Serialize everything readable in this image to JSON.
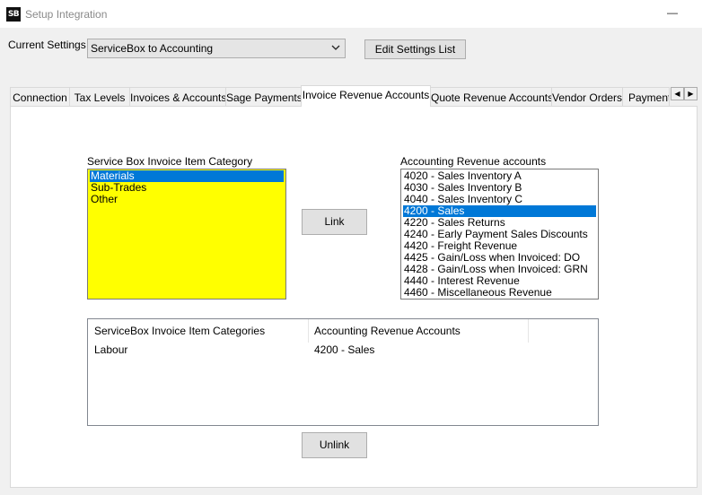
{
  "window": {
    "app_icon_text": "SB",
    "title": "Setup Integration",
    "minimize_glyph": "—"
  },
  "settings": {
    "label": "Current Settings",
    "selected": "ServiceBox to Accounting",
    "edit_button": "Edit Settings List"
  },
  "tabs": [
    {
      "label": "Connection",
      "active": false
    },
    {
      "label": "Tax Levels",
      "active": false
    },
    {
      "label": "Invoices & Accounts",
      "active": false
    },
    {
      "label": "Sage Payments",
      "active": false
    },
    {
      "label": "Invoice Revenue Accounts",
      "active": true
    },
    {
      "label": "Quote Revenue Accounts",
      "active": false
    },
    {
      "label": "Vendor Orders",
      "active": false
    },
    {
      "label": "Payment",
      "active": false
    }
  ],
  "tab_scroll": {
    "left": "◀",
    "right": "▶"
  },
  "category_list": {
    "label": "Service Box Invoice Item Category",
    "items": [
      "Materials",
      "Sub-Trades",
      "Other"
    ],
    "selected_index": 0
  },
  "revenue_list": {
    "label": "Accounting Revenue accounts",
    "items": [
      "4020 - Sales Inventory A",
      "4030 - Sales Inventory B",
      "4040 - Sales Inventory C",
      "4200 - Sales",
      "4220 - Sales Returns",
      "4240 - Early Payment Sales Discounts",
      "4420 - Freight Revenue",
      "4425 - Gain/Loss when Invoiced: DO",
      "4428 - Gain/Loss when Invoiced: GRN",
      "4440 - Interest Revenue",
      "4460 - Miscellaneous Revenue"
    ],
    "selected_index": 3
  },
  "buttons": {
    "link": "Link",
    "unlink": "Unlink"
  },
  "linked_grid": {
    "columns": [
      "ServiceBox Invoice Item Categories",
      "Accounting Revenue Accounts"
    ],
    "rows": [
      [
        "Labour",
        "4200 - Sales"
      ]
    ]
  }
}
